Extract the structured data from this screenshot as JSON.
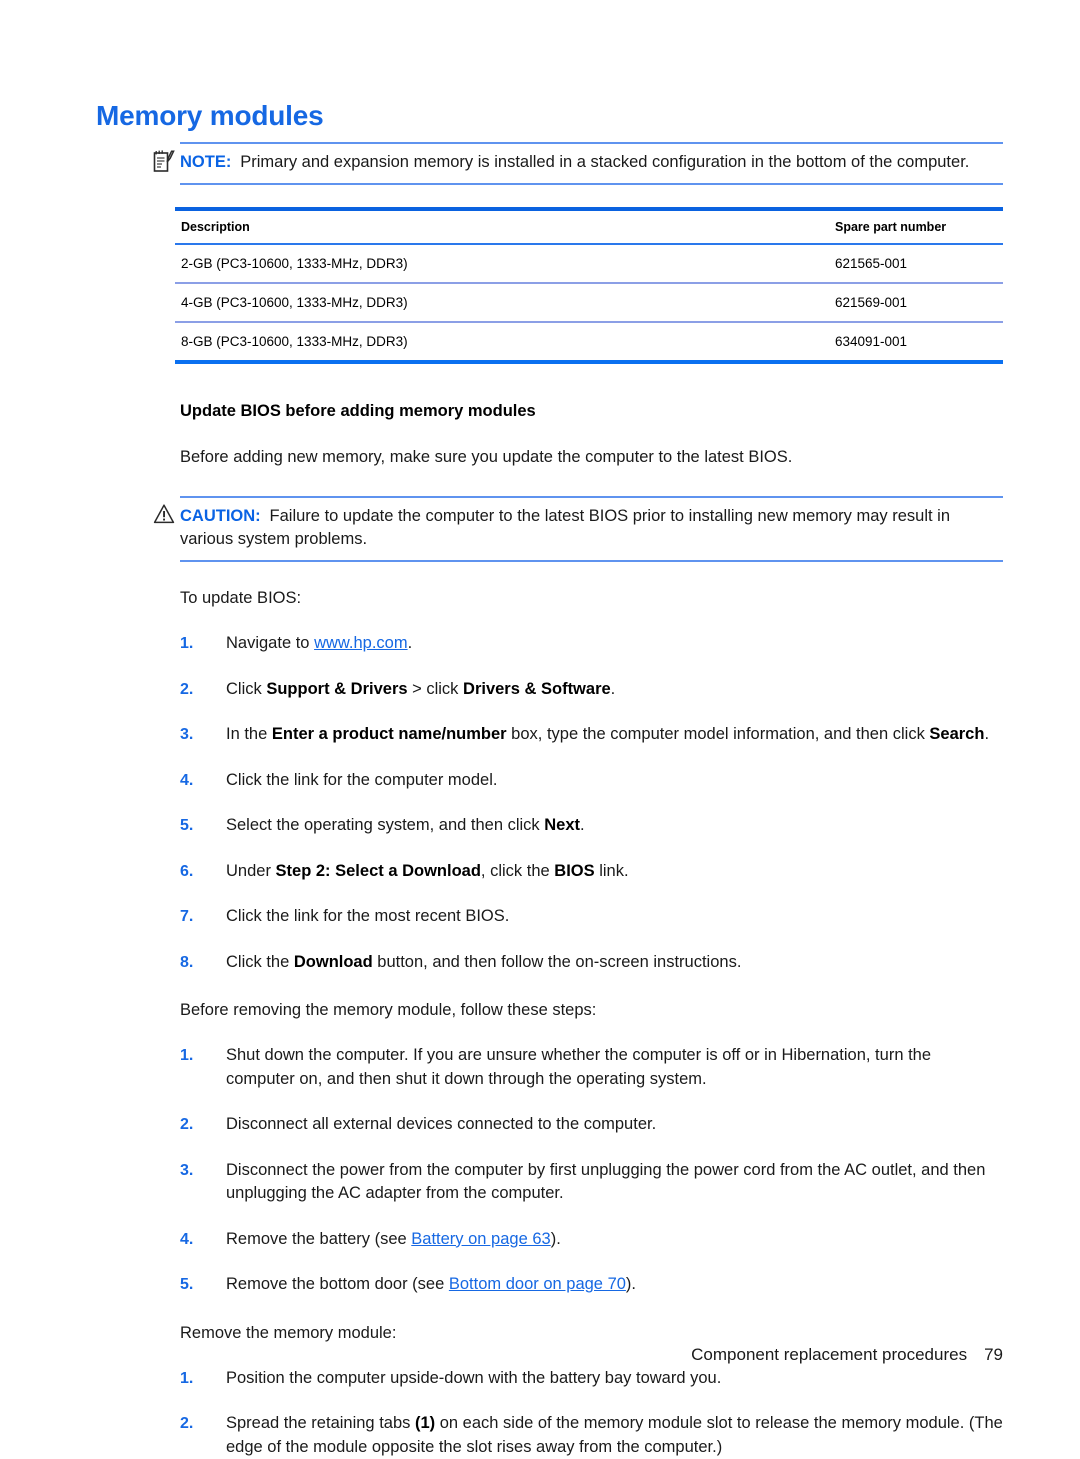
{
  "page": {
    "heading": "Memory modules",
    "footer_text": "Component replacement procedures",
    "footer_page": "79"
  },
  "note": {
    "icon": "note-pad-pencil-icon",
    "label": "NOTE:",
    "text": "Primary and expansion memory is installed in a stacked configuration in the bottom of the computer."
  },
  "parts_table": {
    "columns": [
      "Description",
      "Spare part number"
    ],
    "rows": [
      {
        "description": "2-GB (PC3-10600, 1333-MHz, DDR3)",
        "spare_part_number": "621565-001"
      },
      {
        "description": "4-GB (PC3-10600, 1333-MHz, DDR3)",
        "spare_part_number": "621569-001"
      },
      {
        "description": "8-GB (PC3-10600, 1333-MHz, DDR3)",
        "spare_part_number": "634091-001"
      }
    ]
  },
  "bios_section": {
    "subhead": "Update BIOS before adding memory modules",
    "intro": "Before adding new memory, make sure you update the computer to the latest BIOS.",
    "caution": {
      "icon": "warning-triangle-icon",
      "label": "CAUTION:",
      "text": "Failure to update the computer to the latest BIOS prior to installing new memory may result in various system problems."
    },
    "lead_in": "To update BIOS:",
    "steps": [
      {
        "num": "1.",
        "pre": "Navigate to ",
        "link": "www.hp.com",
        "post": "."
      },
      {
        "num": "2.",
        "seg": [
          {
            "t": "Click ",
            "bold": false
          },
          {
            "t": "Support & Drivers",
            "bold": true
          },
          {
            "t": " > click ",
            "bold": false
          },
          {
            "t": "Drivers & Software",
            "bold": true
          },
          {
            "t": ".",
            "bold": false
          }
        ]
      },
      {
        "num": "3.",
        "seg": [
          {
            "t": "In the ",
            "bold": false
          },
          {
            "t": "Enter a product name/number",
            "bold": true
          },
          {
            "t": " box, type the computer model information, and then click ",
            "bold": false
          },
          {
            "t": "Search",
            "bold": true
          },
          {
            "t": ".",
            "bold": false
          }
        ]
      },
      {
        "num": "4.",
        "seg": [
          {
            "t": "Click the link for the computer model.",
            "bold": false
          }
        ]
      },
      {
        "num": "5.",
        "seg": [
          {
            "t": "Select the operating system, and then click ",
            "bold": false
          },
          {
            "t": "Next",
            "bold": true
          },
          {
            "t": ".",
            "bold": false
          }
        ]
      },
      {
        "num": "6.",
        "seg": [
          {
            "t": "Under ",
            "bold": false
          },
          {
            "t": "Step 2: Select a Download",
            "bold": true
          },
          {
            "t": ", click the ",
            "bold": false
          },
          {
            "t": "BIOS",
            "bold": true
          },
          {
            "t": " link.",
            "bold": false
          }
        ]
      },
      {
        "num": "7.",
        "seg": [
          {
            "t": "Click the link for the most recent BIOS.",
            "bold": false
          }
        ]
      },
      {
        "num": "8.",
        "seg": [
          {
            "t": "Click the ",
            "bold": false
          },
          {
            "t": "Download",
            "bold": true
          },
          {
            "t": " button, and then follow the on-screen instructions.",
            "bold": false
          }
        ]
      }
    ]
  },
  "before_removing": {
    "lead_in": "Before removing the memory module, follow these steps:",
    "steps": [
      {
        "num": "1.",
        "seg": [
          {
            "t": "Shut down the computer. If you are unsure whether the computer is off or in Hibernation, turn the computer on, and then shut it down through the operating system.",
            "bold": false
          }
        ]
      },
      {
        "num": "2.",
        "seg": [
          {
            "t": "Disconnect all external devices connected to the computer.",
            "bold": false
          }
        ]
      },
      {
        "num": "3.",
        "seg": [
          {
            "t": "Disconnect the power from the computer by first unplugging the power cord from the AC outlet, and then unplugging the AC adapter from the computer.",
            "bold": false
          }
        ]
      },
      {
        "num": "4.",
        "seg": [
          {
            "t": "Remove the battery (see ",
            "bold": false
          },
          {
            "t": "Battery on page 63",
            "bold": false,
            "link": true
          },
          {
            "t": ").",
            "bold": false
          }
        ]
      },
      {
        "num": "5.",
        "seg": [
          {
            "t": "Remove the bottom door (see ",
            "bold": false
          },
          {
            "t": "Bottom door on page 70",
            "bold": false,
            "link": true
          },
          {
            "t": ").",
            "bold": false
          }
        ]
      }
    ]
  },
  "remove_module": {
    "lead_in": "Remove the memory module:",
    "steps": [
      {
        "num": "1.",
        "seg": [
          {
            "t": "Position the computer upside-down with the battery bay toward you.",
            "bold": false
          }
        ]
      },
      {
        "num": "2.",
        "seg": [
          {
            "t": "Spread the retaining tabs ",
            "bold": false
          },
          {
            "t": "(1)",
            "bold": true
          },
          {
            "t": " on each side of the memory module slot to release the memory module. (The edge of the module opposite the slot rises away from the computer.)",
            "bold": false
          }
        ]
      }
    ]
  },
  "colors": {
    "heading_blue": "#1668e3",
    "label_blue": "#0a63e4",
    "link_blue": "#1668e3",
    "rule_blue": "#5f93ef",
    "table_top_blue": "#0a62e0",
    "table_row_blue": "#8b9fe6",
    "table_bottom_blue": "#0a70f0"
  }
}
